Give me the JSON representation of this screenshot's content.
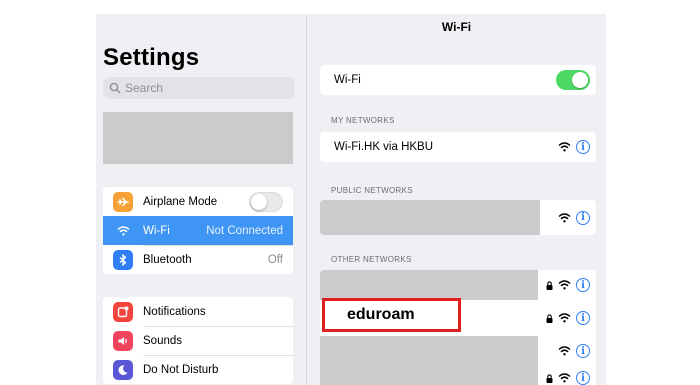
{
  "left": {
    "title": "Settings",
    "search_placeholder": "Search",
    "group1": [
      {
        "label": "Airplane Mode",
        "icon": "airplane-icon",
        "color": "#f7a236"
      },
      {
        "label": "Wi-Fi",
        "value": "Not Connected",
        "icon": "wifi-icon",
        "color": "#3f95f3"
      },
      {
        "label": "Bluetooth",
        "value": "Off",
        "icon": "bluetooth-icon",
        "color": "#2f7ef6"
      }
    ],
    "group2": [
      {
        "label": "Notifications",
        "icon": "notifications-icon",
        "color": "#f2443a"
      },
      {
        "label": "Sounds",
        "icon": "sounds-icon",
        "color": "#f2435d"
      },
      {
        "label": "Do Not Disturb",
        "icon": "moon-icon",
        "color": "#5a57d6"
      }
    ]
  },
  "right": {
    "nav_title": "Wi-Fi",
    "wifi_toggle_label": "Wi-Fi",
    "sections": {
      "my_networks": "MY NETWORKS",
      "public_networks": "PUBLIC NETWORKS",
      "other_networks": "OTHER NETWORKS"
    },
    "my_network_name": "Wi-Fi.HK via HKBU",
    "highlighted_network": "eduroam"
  },
  "colors": {
    "accent": "#3f95f3",
    "toggle_on": "#4cd964",
    "highlight_border": "#e02020",
    "info": "#2f7ef6"
  }
}
